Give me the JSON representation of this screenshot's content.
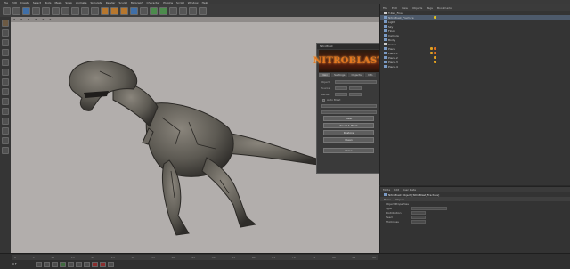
{
  "menu": [
    "File",
    "Edit",
    "Create",
    "Select",
    "Tools",
    "Mesh",
    "Snap",
    "Animate",
    "Simulate",
    "Render",
    "Sculpt",
    "MoGraph",
    "Character",
    "Plugins",
    "Script",
    "Window",
    "Help"
  ],
  "plugin": {
    "window_title": "NitroBlast",
    "banner": "NITROBLAST",
    "tabs": [
      "Main",
      "Settings",
      "Objects",
      "Info"
    ],
    "fields": [
      {
        "label": "Object"
      },
      {
        "label": "Source"
      },
      {
        "label": "Pieces"
      }
    ],
    "checkbox": "Auto Blast",
    "buttons": [
      "Blast",
      "Reset & Blast",
      "Restore",
      "Clean",
      "Close"
    ]
  },
  "object_manager": {
    "menus": [
      "File",
      "Edit",
      "View",
      "Objects",
      "Tags",
      "Bookmarks"
    ],
    "rows": [
      {
        "name": "T-Rex_Final",
        "selected": false,
        "icon": "null"
      },
      {
        "name": "NitroBlast_Fracture",
        "selected": true,
        "icon": "obj"
      },
      {
        "name": "Light",
        "selected": false,
        "icon": "obj"
      },
      {
        "name": "Sky",
        "selected": false,
        "icon": "obj"
      },
      {
        "name": "Floor",
        "selected": false,
        "icon": "obj"
      },
      {
        "name": "Camera",
        "selected": false,
        "icon": "obj"
      },
      {
        "name": "Body",
        "selected": false,
        "icon": "obj"
      },
      {
        "name": "Group",
        "selected": false,
        "icon": "null"
      },
      {
        "name": "Piece",
        "selected": false,
        "icon": "obj"
      },
      {
        "name": "Piece.1",
        "selected": false,
        "icon": "obj"
      },
      {
        "name": "Piece.2",
        "selected": false,
        "icon": "obj"
      },
      {
        "name": "Piece.3",
        "selected": false,
        "icon": "obj"
      },
      {
        "name": "Piece.4",
        "selected": false,
        "icon": "obj"
      }
    ]
  },
  "attributes": {
    "menus": [
      "Mode",
      "Edit",
      "User Data"
    ],
    "title": "NitroBlast Object [NitroBlast_Fracture]",
    "subtabs": [
      "Basic",
      "Object"
    ],
    "section": "Object Properties",
    "rows": [
      {
        "label": "Type"
      },
      {
        "label": "Distribution"
      },
      {
        "label": "Seed"
      },
      {
        "label": "Thickness"
      }
    ]
  },
  "timeline": {
    "ticks": [
      "0",
      "5",
      "10",
      "15",
      "20",
      "25",
      "30",
      "35",
      "40",
      "45",
      "50",
      "55",
      "60",
      "65",
      "70",
      "75",
      "80",
      "85",
      "90"
    ],
    "frame": "0 F"
  },
  "colors": {
    "accent": "#4d5a6b",
    "banner_text": "#e4771f",
    "viewport": "#b2aeac"
  }
}
